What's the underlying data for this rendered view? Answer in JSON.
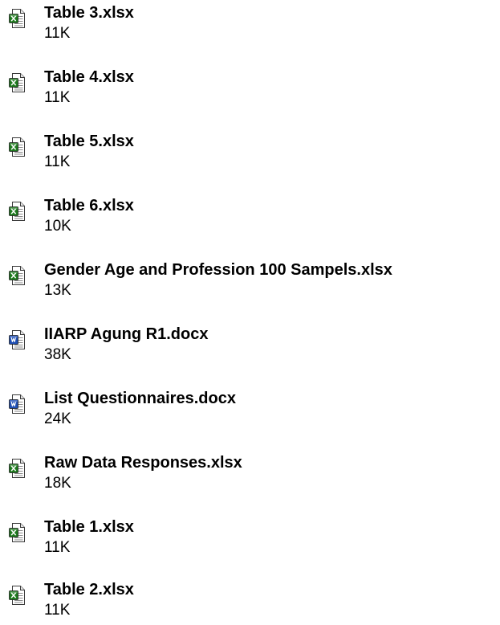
{
  "files": [
    {
      "name": "Table 3.xlsx",
      "size": "11K",
      "icon": "excel-file-icon"
    },
    {
      "name": "Table 4.xlsx",
      "size": "11K",
      "icon": "excel-file-icon"
    },
    {
      "name": "Table 5.xlsx",
      "size": "11K",
      "icon": "excel-file-icon"
    },
    {
      "name": "Table 6.xlsx",
      "size": "10K",
      "icon": "excel-file-icon"
    },
    {
      "name": "Gender Age and Profession 100 Sampels.xlsx",
      "size": "13K",
      "icon": "excel-file-icon"
    },
    {
      "name": "IIARP Agung R1.docx",
      "size": "38K",
      "icon": "word-file-icon"
    },
    {
      "name": "List Questionnaires.docx",
      "size": "24K",
      "icon": "word-file-icon"
    },
    {
      "name": "Raw Data Responses.xlsx",
      "size": "18K",
      "icon": "excel-file-icon"
    },
    {
      "name": "Table 1.xlsx",
      "size": "11K",
      "icon": "excel-file-icon"
    },
    {
      "name": "Table 2.xlsx",
      "size": "11K",
      "icon": "excel-file-icon"
    }
  ],
  "colors": {
    "excel_accent": "#1e7a1e",
    "word_accent": "#1f4fb4",
    "text": "#000000",
    "background": "#ffffff"
  }
}
